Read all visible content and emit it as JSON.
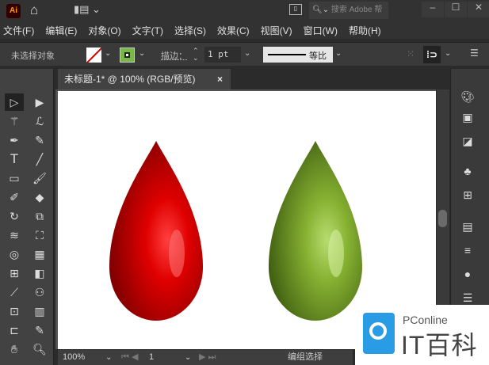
{
  "app": {
    "logo": "Ai",
    "search_placeholder": "搜索 Adobe 帮助"
  },
  "menu": [
    "文件(F)",
    "编辑(E)",
    "对象(O)",
    "文字(T)",
    "选择(S)",
    "效果(C)",
    "视图(V)",
    "窗口(W)",
    "帮助(H)"
  ],
  "control": {
    "selection": "未选择对象",
    "stroke_label": "描边：",
    "stroke_value": "1 pt",
    "profile": "等比",
    "fill_color": "#7ab648"
  },
  "tab": {
    "title": "未标题-1* @ 100% (RGB/预览)",
    "close": "×"
  },
  "status": {
    "zoom": "100%",
    "page": "1",
    "tool": "编组选择"
  },
  "watermark": {
    "brand": "PConline",
    "name": "IT百科"
  },
  "artwork": {
    "drops": [
      {
        "color": "#d00000"
      },
      {
        "color": "#7aa82a"
      }
    ]
  }
}
